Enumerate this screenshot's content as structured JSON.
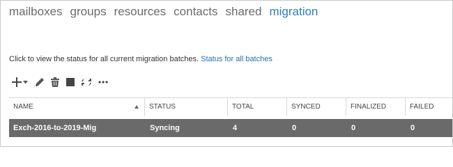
{
  "nav": {
    "tabs": [
      {
        "label": "mailboxes",
        "active": false
      },
      {
        "label": "groups",
        "active": false
      },
      {
        "label": "resources",
        "active": false
      },
      {
        "label": "contacts",
        "active": false
      },
      {
        "label": "shared",
        "active": false
      },
      {
        "label": "migration",
        "active": true
      }
    ]
  },
  "info": {
    "text": "Click to view the status for all current migration batches.",
    "link": "Status for all batches"
  },
  "toolbar": {
    "icons": [
      "plus-icon",
      "chevron-down-icon",
      "pencil-icon",
      "trash-icon",
      "stop-icon",
      "refresh-icon",
      "more-icon"
    ]
  },
  "table": {
    "columns": [
      "NAME",
      "STATUS",
      "TOTAL",
      "SYNCED",
      "FINALIZED",
      "FAILED"
    ],
    "sort": {
      "column": "NAME",
      "direction": "ascending"
    },
    "rows": [
      {
        "name": "Exch-2016-to-2019-Mig",
        "status": "Syncing",
        "total": "4",
        "synced": "0",
        "finalized": "0",
        "failed": "0"
      }
    ]
  },
  "colors": {
    "accent": "#2f7dbf",
    "link": "#1f6fb3",
    "selected_row": "#6a6a6a",
    "tab_text": "#6b6b6b"
  }
}
